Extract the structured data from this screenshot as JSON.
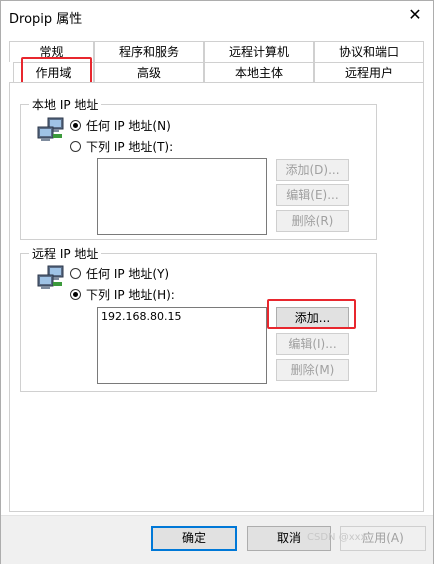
{
  "window": {
    "title": "Dropip 属性",
    "close_glyph": "✕"
  },
  "tabs": {
    "row_top": [
      "常规",
      "程序和服务",
      "远程计算机",
      "协议和端口"
    ],
    "row_bottom": [
      "作用域",
      "高级",
      "本地主体",
      "远程用户"
    ],
    "active": "作用域"
  },
  "local_ip": {
    "group_label": "本地 IP 地址",
    "any_label": "任何 IP 地址(N)",
    "list_label": "下列 IP 地址(T):",
    "selected": "any",
    "entries": [],
    "add_label": "添加(D)...",
    "edit_label": "编辑(E)...",
    "delete_label": "删除(R)"
  },
  "remote_ip": {
    "group_label": "远程 IP 地址",
    "any_label": "任何 IP 地址(Y)",
    "list_label": "下列 IP 地址(H):",
    "selected": "list",
    "entries": [
      "192.168.80.15"
    ],
    "add_label": "添加...",
    "edit_label": "编辑(I)...",
    "delete_label": "删除(M)"
  },
  "footer": {
    "ok_label": "确定",
    "cancel_label": "取消",
    "apply_label": "应用(A)",
    "watermark": "CSDN @xxx"
  },
  "icons": {
    "network": "network-computers-icon",
    "radio": "radio-icon"
  },
  "colors": {
    "highlight": "#e8272e",
    "focus": "#0078d7"
  }
}
